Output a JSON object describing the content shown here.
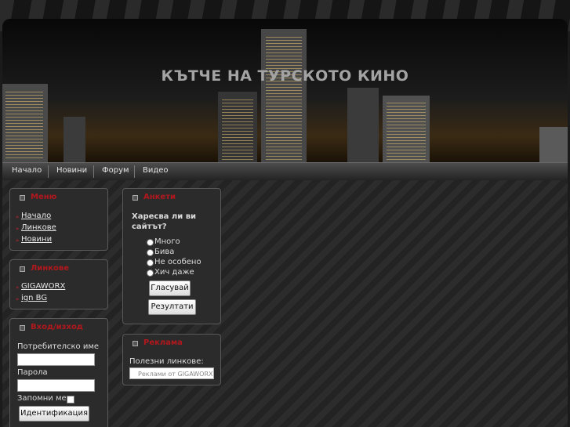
{
  "site": {
    "title": "КЪТЧЕ НА ТУРСКОТО КИНО"
  },
  "nav": [
    {
      "label": "Начало"
    },
    {
      "label": "Новини"
    },
    {
      "label": "Форум"
    },
    {
      "label": "Видео"
    }
  ],
  "menu_box": {
    "title": "Меню",
    "links": [
      {
        "label": "Начало"
      },
      {
        "label": "Линкове"
      },
      {
        "label": "Новини"
      }
    ]
  },
  "links_box": {
    "title": "Линкове",
    "links": [
      {
        "label": "GIGAWORX"
      },
      {
        "label": "ign BG"
      }
    ]
  },
  "login_box": {
    "title": "Вход/изход",
    "username_label": "Потребителско име",
    "password_label": "Парола",
    "remember_label": "Запомни ме",
    "submit_label": "Идентификация"
  },
  "poll_box": {
    "title": "Анкети",
    "question_line1": "Харесва ли ви",
    "question_line2": "сайтът?",
    "options": [
      {
        "label": "Много"
      },
      {
        "label": "Бива"
      },
      {
        "label": "Не особено"
      },
      {
        "label": "Хич даже"
      }
    ],
    "vote_label": "Гласувай",
    "results_label": "Резултати"
  },
  "ads_box": {
    "title": "Реклама",
    "text": "Полезни линкове:",
    "banner_label": "Реклами от GIGAWORX"
  },
  "colors": {
    "accent_title": "#b0181d",
    "background": "#1b1b1b"
  }
}
